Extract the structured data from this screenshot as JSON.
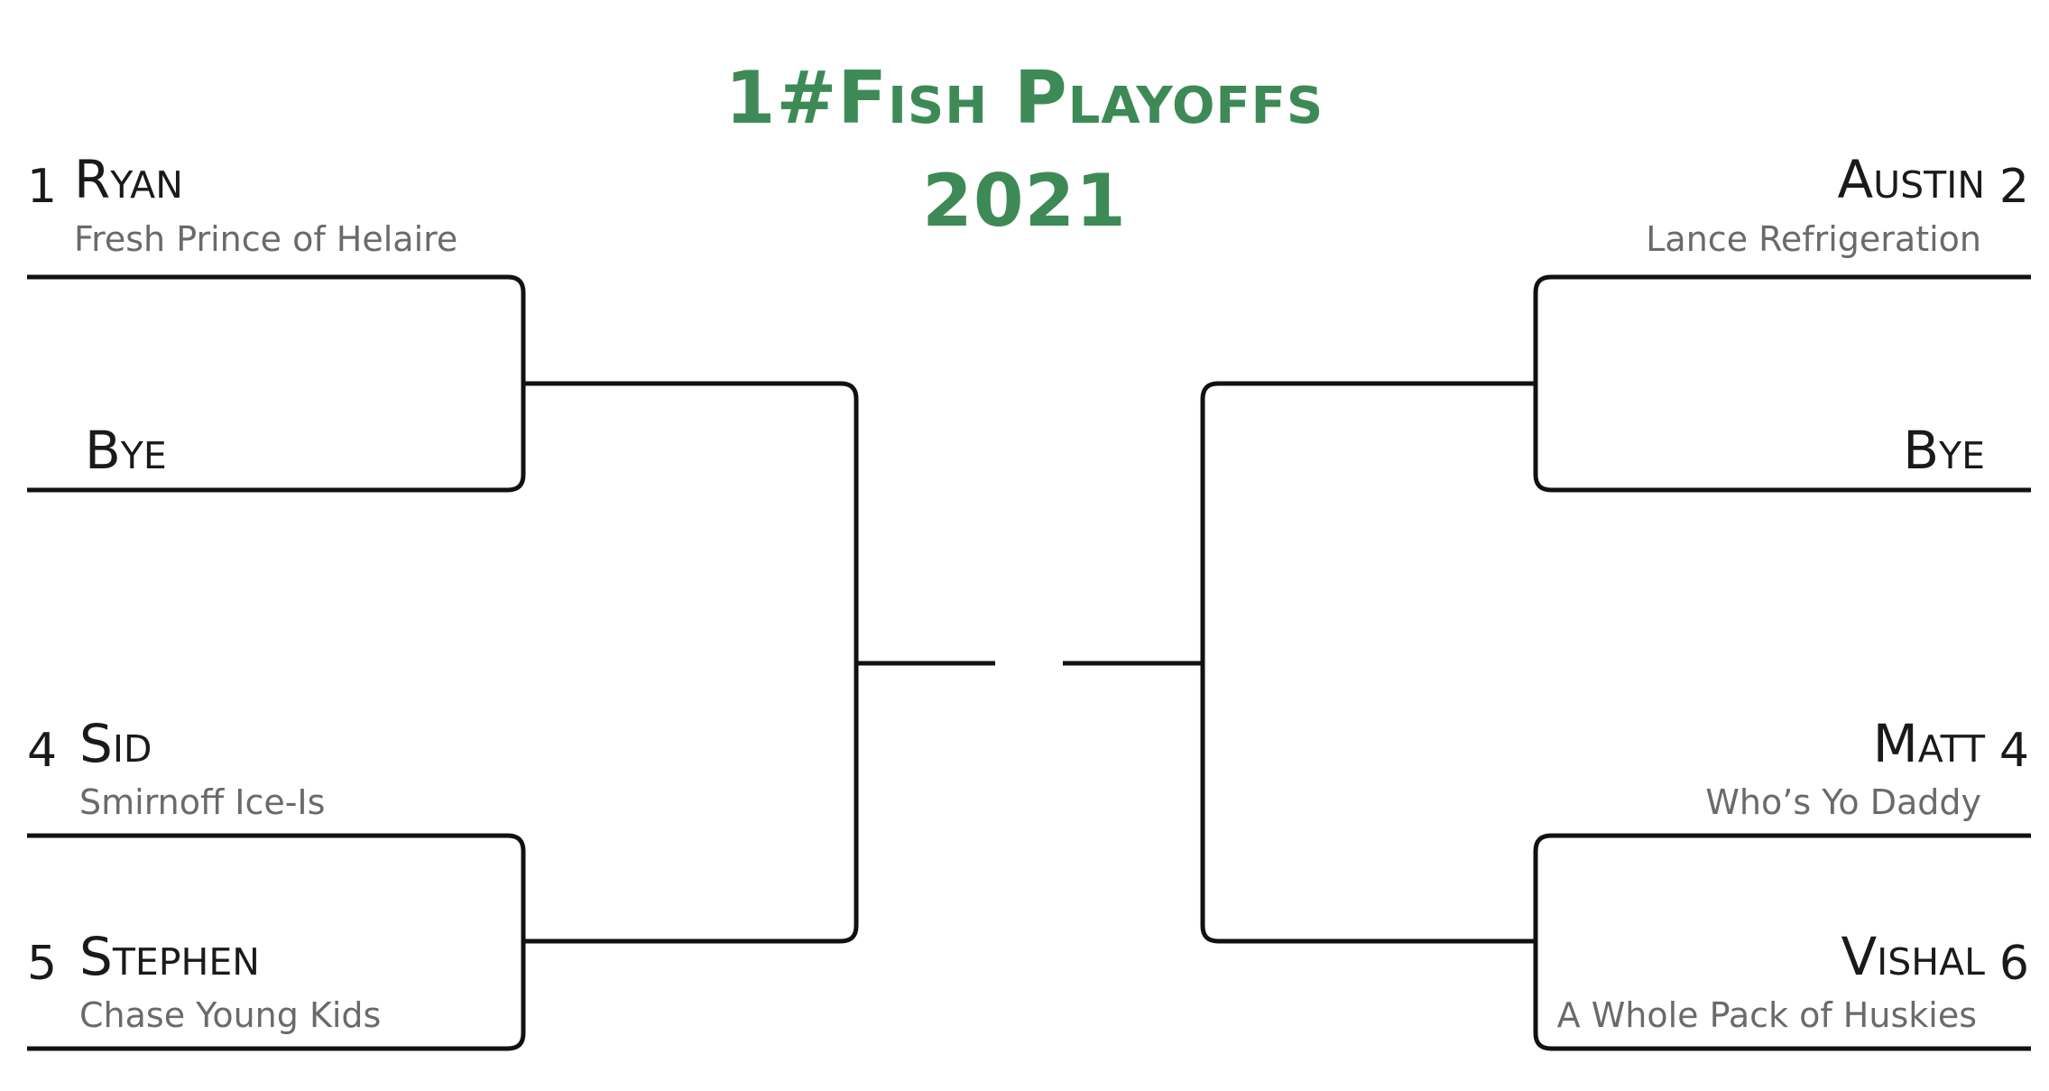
{
  "title": {
    "line1": "1#Fish Playoffs",
    "line2": "2021"
  },
  "bracket": {
    "left": {
      "top_match": {
        "team1": {
          "seed": "1",
          "name": "Ryan",
          "team": "Fresh Prince of Helaire"
        },
        "team2": {
          "seed": "",
          "name": "Bye",
          "team": ""
        }
      },
      "bottom_match": {
        "team1": {
          "seed": "4",
          "name": "Sid",
          "team": "Smirnoff Ice-Is"
        },
        "team2": {
          "seed": "5",
          "name": "Stephen",
          "team": "Chase Young Kids"
        }
      }
    },
    "right": {
      "top_match": {
        "team1": {
          "seed": "2",
          "name": "Austin",
          "team": "Lance Refrigeration"
        },
        "team2": {
          "seed": "",
          "name": "Bye",
          "team": ""
        }
      },
      "bottom_match": {
        "team1": {
          "seed": "4",
          "name": "Matt",
          "team": "Who’s Yo Daddy"
        },
        "team2": {
          "seed": "6",
          "name": "Vishal",
          "team": "A Whole Pack of Huskies"
        }
      }
    }
  },
  "colors": {
    "title": "#3d8a57",
    "lines": "#111111",
    "team_subtitle": "#6a6a6a"
  }
}
